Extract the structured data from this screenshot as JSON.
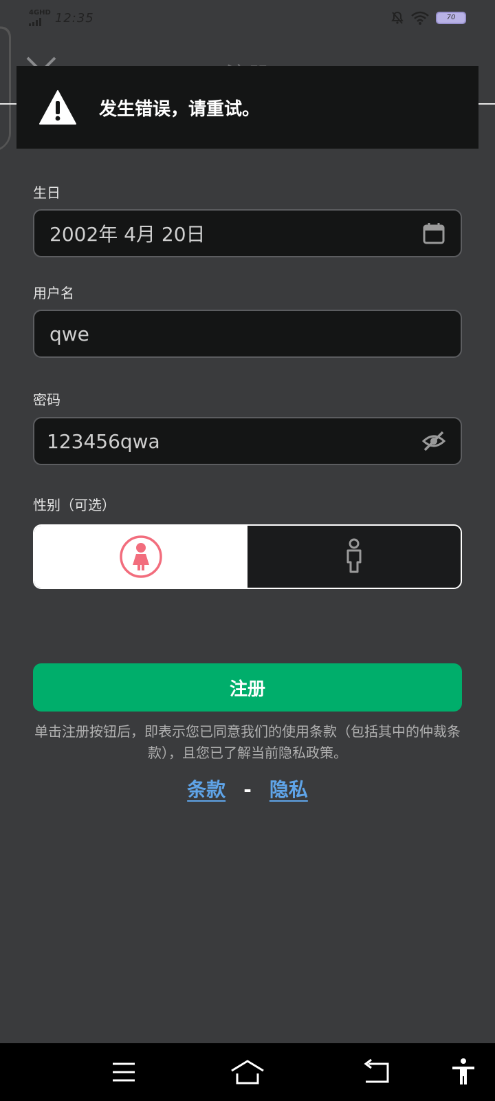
{
  "status_bar": {
    "network": "4GHD",
    "time": "12:35",
    "battery": "70",
    "icons": [
      "signal-icon",
      "bell-off-icon",
      "wifi-icon",
      "battery-icon"
    ]
  },
  "header": {
    "title": "注册",
    "close_icon": "close-icon"
  },
  "toast": {
    "icon": "warning-icon",
    "message": "发生错误，请重试。"
  },
  "form": {
    "birthday": {
      "label": "生日",
      "value": "2002年 4月 20日",
      "icon": "calendar-icon"
    },
    "username": {
      "label": "用户名",
      "value": "qwe"
    },
    "password": {
      "label": "密码",
      "value": "123456qwa",
      "icon": "eye-off-icon"
    },
    "gender": {
      "label": "性别（可选）",
      "options": [
        {
          "name": "female",
          "icon": "female-icon",
          "selected": true
        },
        {
          "name": "male",
          "icon": "male-icon",
          "selected": false
        }
      ]
    }
  },
  "register_button": "注册",
  "terms_text": "单击注册按钮后，即表示您已同意我们的使用条款（包括其中的仲裁条款），且您已了解当前隐私政策。",
  "links": {
    "terms": "条款",
    "separator": "-",
    "privacy": "隐私"
  },
  "nav_bar": {
    "icons": [
      "menu-icon",
      "home-icon",
      "back-icon",
      "accessibility-icon"
    ]
  },
  "colors": {
    "background": "#3a3b3d",
    "field": "#141515",
    "accent_green": "#00ae6b",
    "link_blue": "#5fa4e8",
    "female_pink": "#f26d7d"
  }
}
